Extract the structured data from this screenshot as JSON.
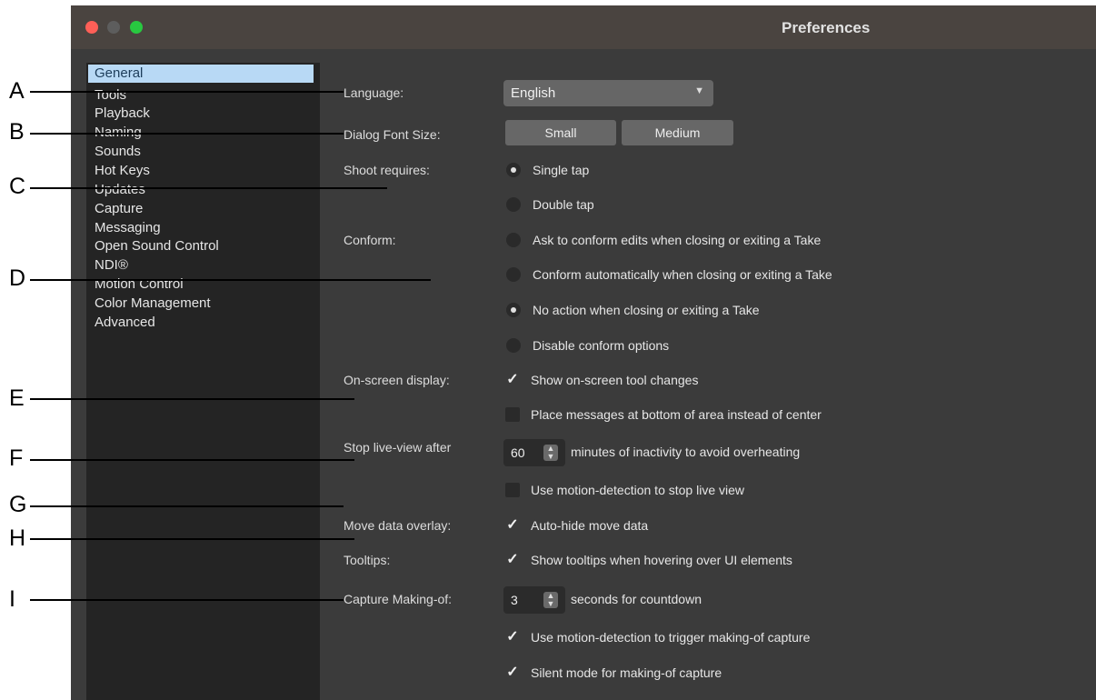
{
  "window": {
    "title": "Preferences"
  },
  "sidebar": {
    "items": [
      "General",
      "Tools",
      "Playback",
      "Naming",
      "Sounds",
      "Hot Keys",
      "Updates",
      "Capture",
      "Messaging",
      "Open Sound Control",
      "NDI®",
      "Motion Control",
      "Color Management",
      "Advanced"
    ],
    "selected": "General"
  },
  "prefs": {
    "language": {
      "label": "Language:",
      "value": "English"
    },
    "font_size": {
      "label": "Dialog Font Size:",
      "options": [
        "Small",
        "Medium"
      ]
    },
    "shoot": {
      "label": "Shoot requires:",
      "options": [
        "Single tap",
        "Double tap"
      ],
      "selected": "Single tap"
    },
    "conform": {
      "label": "Conform:",
      "options": [
        "Ask to conform edits when closing or exiting a Take",
        "Conform automatically when closing or exiting a Take",
        "No action when closing or exiting a Take",
        "Disable conform options"
      ],
      "selected": "No action when closing or exiting a Take"
    },
    "osd": {
      "label": "On-screen display:",
      "show_tool_changes": "Show on-screen tool changes",
      "place_bottom": "Place messages at bottom of area instead of center"
    },
    "live_view": {
      "label": "Stop live-view after",
      "minutes": "60",
      "suffix": "minutes of inactivity to avoid overheating",
      "motion_detect": "Use motion-detection to stop live view"
    },
    "move_data": {
      "label": "Move data overlay:",
      "auto_hide": "Auto-hide move data"
    },
    "tooltips": {
      "label": "Tooltips:",
      "show": "Show tooltips when hovering over UI elements"
    },
    "making_of": {
      "label": "Capture Making-of:",
      "seconds": "3",
      "suffix": "seconds for countdown",
      "motion_trigger": "Use motion-detection to trigger making-of capture",
      "silent": "Silent mode for making-of capture"
    }
  },
  "callouts": [
    "A",
    "B",
    "C",
    "D",
    "E",
    "F",
    "G",
    "H",
    "I"
  ]
}
